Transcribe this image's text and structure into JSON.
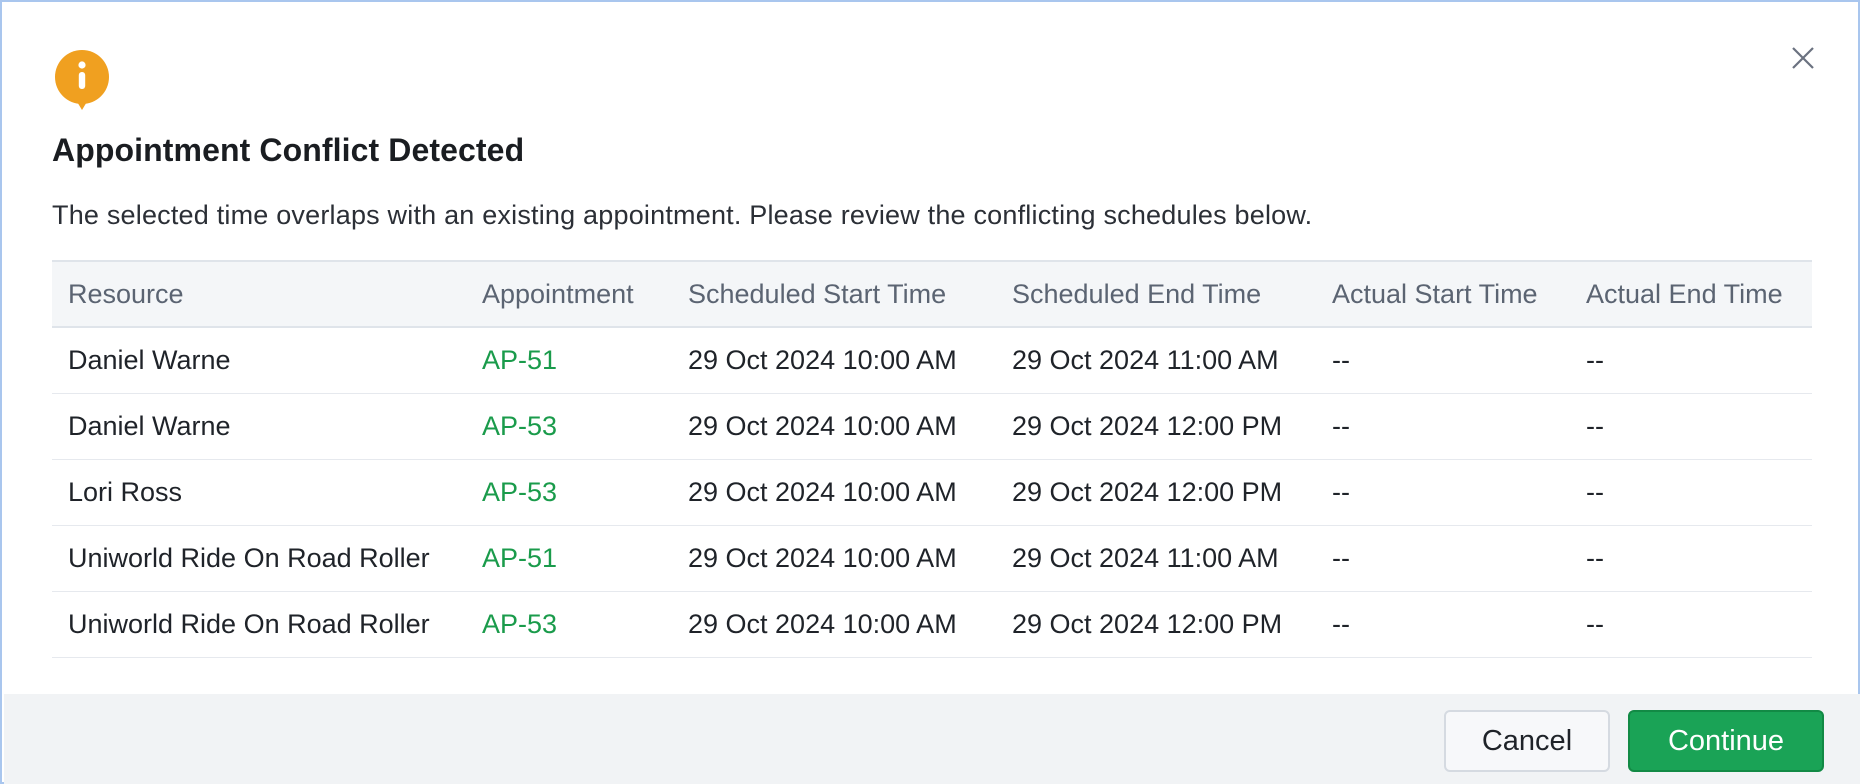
{
  "dialog": {
    "title": "Appointment Conflict Detected",
    "message": "The selected time overlaps with an existing appointment. Please review the conflicting schedules below.",
    "icon": "info-icon",
    "close_icon": "close-icon",
    "colors": {
      "accent": "#1aa356",
      "link": "#1a9b4b",
      "info": "#f0a020",
      "border": "#a9c6ee"
    }
  },
  "table": {
    "columns": [
      "Resource",
      "Appointment",
      "Scheduled Start Time",
      "Scheduled End Time",
      "Actual Start Time",
      "Actual End Time"
    ],
    "rows": [
      [
        "Daniel Warne",
        "AP-51",
        "29 Oct 2024 10:00 AM",
        "29 Oct 2024 11:00 AM",
        "--",
        "--"
      ],
      [
        "Daniel Warne",
        "AP-53",
        "29 Oct 2024 10:00 AM",
        "29 Oct 2024 12:00 PM",
        "--",
        "--"
      ],
      [
        "Lori Ross",
        "AP-53",
        "29 Oct 2024 10:00 AM",
        "29 Oct 2024 12:00 PM",
        "--",
        "--"
      ],
      [
        "Uniworld Ride On Road Roller",
        "AP-51",
        "29 Oct 2024 10:00 AM",
        "29 Oct 2024 11:00 AM",
        "--",
        "--"
      ],
      [
        "Uniworld Ride On Road Roller",
        "AP-53",
        "29 Oct 2024 10:00 AM",
        "29 Oct 2024 12:00 PM",
        "--",
        "--"
      ]
    ]
  },
  "footer": {
    "cancel_label": "Cancel",
    "continue_label": "Continue"
  }
}
